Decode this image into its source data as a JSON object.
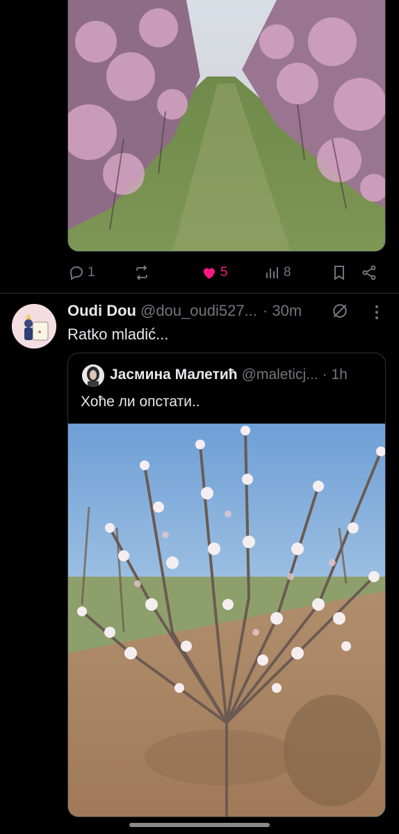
{
  "previous_post": {
    "actions": {
      "reply_count": "1",
      "repost_count": "",
      "like_count": "5",
      "views_count": "8"
    },
    "colors": {
      "like": "#f91880",
      "muted": "#71767b"
    }
  },
  "post": {
    "display_name": "Oudi Dou",
    "handle": "@dou_oudi527...",
    "time": "· 30m",
    "text": "Ratko mladić...",
    "quote": {
      "display_name": "Јасмина Малетић",
      "handle": "@maleticj...",
      "time": "· 1h",
      "text": "Хоће ли опстати.."
    }
  },
  "icons": {
    "reply": "reply-icon",
    "repost": "repost-icon",
    "like": "heart-icon",
    "views": "views-icon",
    "bookmark": "bookmark-icon",
    "share": "share-icon",
    "grok": "grok-icon",
    "more": "more-vertical-icon"
  }
}
